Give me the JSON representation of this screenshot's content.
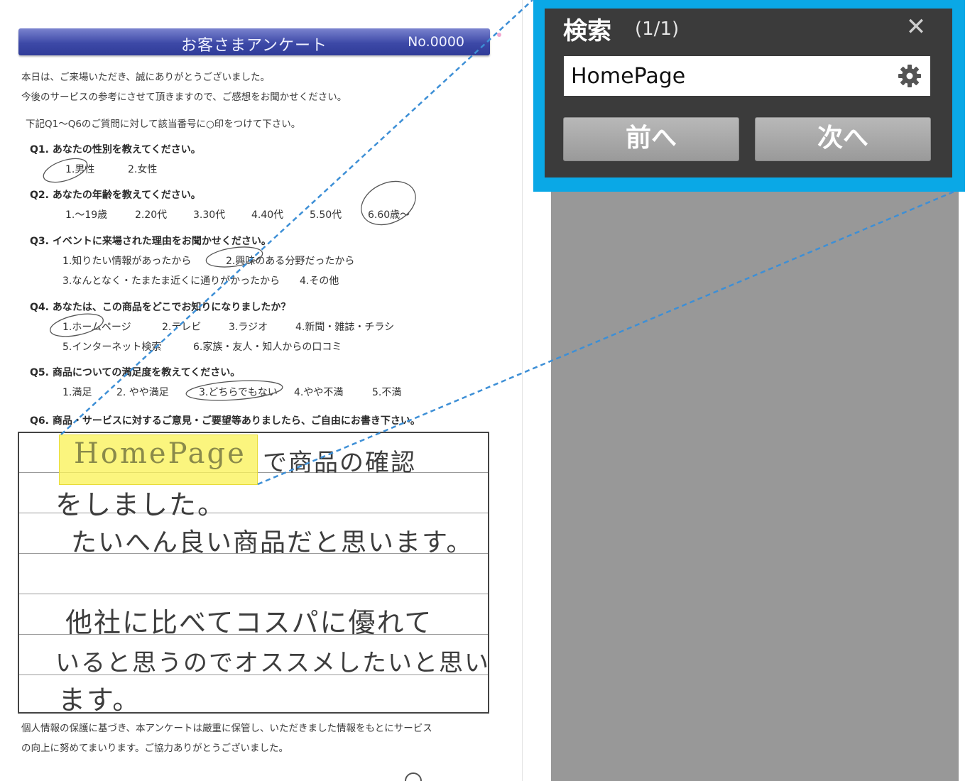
{
  "document": {
    "header_title": "お客さまアンケート",
    "header_no": "No.0000",
    "intro_lines": [
      "本日は、ご来場いただき、誠にありがとうございました。",
      "今後のサービスの参考にさせて頂きますので、ご感想をお聞かせください。"
    ],
    "instruction": "下記Q1～Q6のご質問に対して該当番号に○印をつけて下さい。",
    "q1": {
      "head": "Q1.  あなたの性別を教えてください。",
      "options": [
        "1.男性",
        "2.女性"
      ]
    },
    "q2": {
      "head": "Q2.  あなたの年齢を教えてください。",
      "options": [
        "1.～19歳",
        "2.20代",
        "3.30代",
        "4.40代",
        "5.50代",
        "6.60歳～"
      ]
    },
    "q3": {
      "head": "Q3.  イベントに来場された理由をお聞かせください。",
      "options_row1": [
        "1.知りたい情報があったから",
        "2.興味のある分野だったから"
      ],
      "options_row2": [
        "3.なんとなく・たまたま近くに通りがかったから",
        "4.その他"
      ]
    },
    "q4": {
      "head": "Q4.  あなたは、この商品をどこでお知りになりましたか？",
      "options_row1": [
        "1.ホームページ",
        "2.テレビ",
        "3.ラジオ",
        "4.新聞・雑誌・チラシ"
      ],
      "options_row2": [
        "5.インターネット検索",
        "6.家族・友人・知人からの口コミ"
      ]
    },
    "q5": {
      "head": "Q5.  商品についての満足度を教えてください。",
      "options": [
        "1.満足",
        "2. やや満足",
        "3.どちらでもない",
        "4.やや不満",
        "5.不満"
      ]
    },
    "q6": {
      "head": "Q6.  商品・サービスに対するご意見・ご要望等ありましたら、ご自由にお書き下さい。"
    },
    "handwriting": {
      "highlighted_word": "HomePage",
      "line1_rest": "で商品の確認",
      "line2": "をしました。",
      "line3": "たいへん良い商品だと思います。",
      "line4": "他社に比べてコスパに優れて",
      "line5": "いると思うのでオススメしたいと思い",
      "line6": "ます。"
    },
    "footer_lines": [
      "個人情報の保護に基づき、本アンケートは厳重に保管し、いただきました情報をもとにサービス",
      "の向上に努めてまいります。ご協力ありがとうございました。"
    ]
  },
  "search_panel": {
    "title": "検索",
    "result_count": "(1/1)",
    "close_symbol": "✕",
    "query_value": "HomePage",
    "settings_icon": "gear-icon",
    "prev_label": "前へ",
    "next_label": "次へ"
  },
  "colors": {
    "header_blue": "#3d49a7",
    "highlight_yellow": "#faf25a",
    "search_frame_blue": "#0aa8e6",
    "search_panel_bg": "#3b3b3b",
    "connector_blue": "#3d8fd6",
    "side_panel_gray": "#989898"
  }
}
